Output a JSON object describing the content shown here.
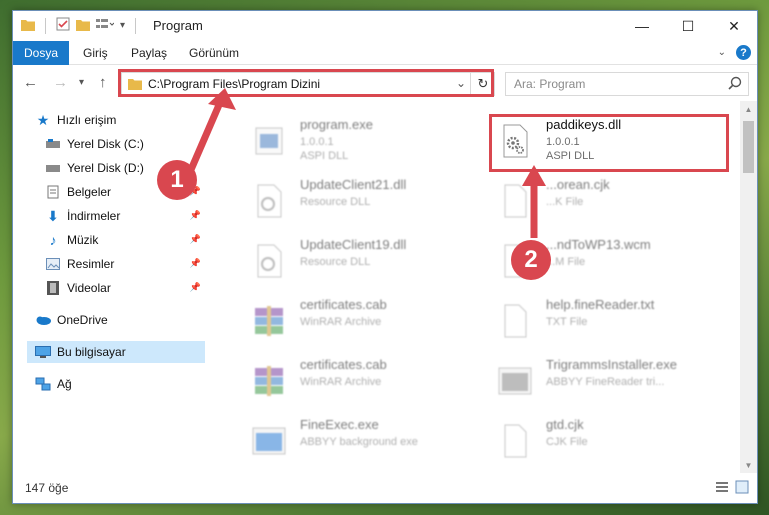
{
  "window": {
    "title": "Program",
    "controls": {
      "minimize": "—",
      "maximize": "☐",
      "close": "✕"
    }
  },
  "ribbon": {
    "tabs": [
      "Dosya",
      "Giriş",
      "Paylaş",
      "Görünüm"
    ],
    "help": "?"
  },
  "address": {
    "path": "C:\\Program Files\\Program Dizini",
    "search_placeholder": "Ara: Program"
  },
  "nav": {
    "quick_access": "Hızlı erişim",
    "items": [
      {
        "label": "Yerel Disk (C:)",
        "icon": "drive-icon"
      },
      {
        "label": "Yerel Disk (D:)",
        "icon": "drive-icon"
      },
      {
        "label": "Belgeler",
        "icon": "documents-icon"
      },
      {
        "label": "İndirmeler",
        "icon": "download-icon"
      },
      {
        "label": "Müzik",
        "icon": "music-icon"
      },
      {
        "label": "Resimler",
        "icon": "pictures-icon"
      },
      {
        "label": "Videolar",
        "icon": "videos-icon"
      }
    ],
    "onedrive": "OneDrive",
    "this_pc": "Bu bilgisayar",
    "network": "Ağ"
  },
  "files": {
    "left": [
      {
        "name": "program.exe",
        "line1": "1.0.0.1",
        "line2": "ASPI DLL",
        "icon": "exe-icon"
      },
      {
        "name": "UpdateClient21.dll",
        "line1": "Resource DLL",
        "line2": "",
        "icon": "dll-icon"
      },
      {
        "name": "UpdateClient19.dll",
        "line1": "Resource DLL",
        "line2": "",
        "icon": "dll-icon"
      },
      {
        "name": "certificates.cab",
        "line1": "WinRAR Archive",
        "line2": "",
        "icon": "archive-icon"
      },
      {
        "name": "certificates.cab",
        "line1": "WinRAR Archive",
        "line2": "",
        "icon": "archive-icon"
      },
      {
        "name": "FineExec.exe",
        "line1": "ABBYY background exe",
        "line2": "",
        "icon": "app-icon"
      }
    ],
    "right": [
      {
        "name": "paddikeys.dll",
        "line1": "1.0.0.1",
        "line2": "ASPI DLL",
        "icon": "dll-icon"
      },
      {
        "name": "...orean.cjk",
        "line1": "...K File",
        "line2": "",
        "icon": "file-icon"
      },
      {
        "name": "...ndToWP13.wcm",
        "line1": "...M File",
        "line2": "",
        "icon": "file-icon"
      },
      {
        "name": "help.fineReader.txt",
        "line1": "TXT File",
        "line2": "",
        "icon": "file-icon"
      },
      {
        "name": "TrigrammsInstaller.exe",
        "line1": "ABBYY FineReader tri...",
        "line2": "",
        "icon": "app-icon"
      },
      {
        "name": "gtd.cjk",
        "line1": "CJK File",
        "line2": "",
        "icon": "file-icon"
      }
    ]
  },
  "status": {
    "count": "147 öğe"
  },
  "callouts": [
    "1",
    "2"
  ],
  "colors": {
    "accent": "#1979ca",
    "highlight": "#d9474f",
    "selected": "#cde8fc"
  }
}
